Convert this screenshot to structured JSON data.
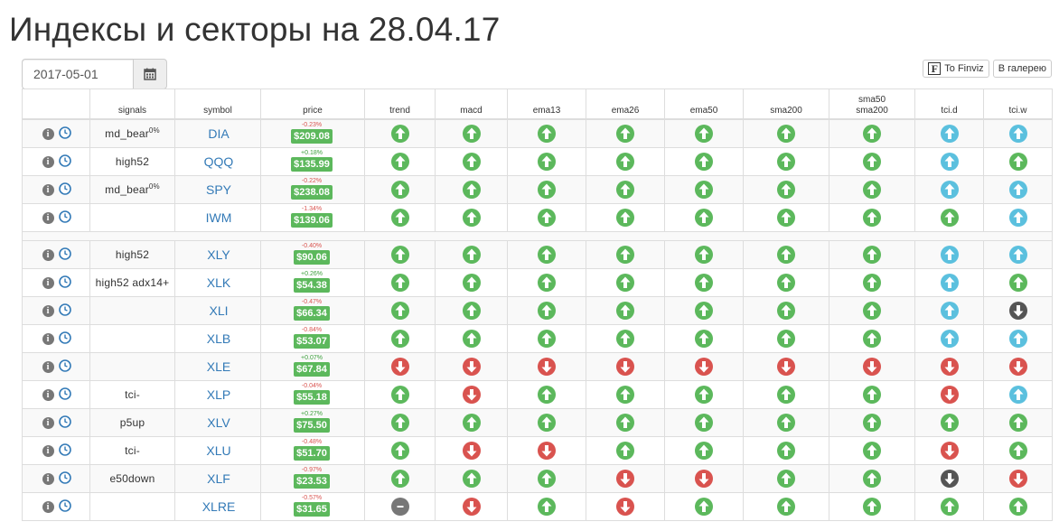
{
  "title": "Индексы и секторы на 28.04.17",
  "date_input": {
    "value": "2017-05-01"
  },
  "buttons": {
    "finviz_icon_letter": "F",
    "finviz_label": "To Finviz",
    "gallery_label": "В галерею"
  },
  "table": {
    "columns": [
      "",
      "signals",
      "symbol",
      "price",
      "trend",
      "macd",
      "ema13",
      "ema26",
      "ema50",
      "sma200",
      "sma50\nsma200",
      "tci.d",
      "tci.w"
    ],
    "column_labels": {
      "signals": "signals",
      "symbol": "symbol",
      "price": "price",
      "trend": "trend",
      "macd": "macd",
      "ema13": "ema13",
      "ema26": "ema26",
      "ema50": "ema50",
      "sma200": "sma200",
      "sma50_sma200_line1": "sma50",
      "sma50_sma200_line2": "sma200",
      "tci_d": "tci.d",
      "tci_w": "tci.w"
    },
    "groups": [
      [
        {
          "symbol": "DIA",
          "signal": "md_bear",
          "signal_sup": "0%",
          "change": "-0.23%",
          "price": "$209.08",
          "indicators": [
            "up",
            "up",
            "up",
            "up",
            "up",
            "up",
            "up",
            "up-blue",
            "up-blue"
          ]
        },
        {
          "symbol": "QQQ",
          "signal": "high52",
          "signal_sup": "",
          "change": "+0.18%",
          "price": "$135.99",
          "indicators": [
            "up",
            "up",
            "up",
            "up",
            "up",
            "up",
            "up",
            "up-blue",
            "up"
          ]
        },
        {
          "symbol": "SPY",
          "signal": "md_bear",
          "signal_sup": "0%",
          "change": "-0.22%",
          "price": "$238.08",
          "indicators": [
            "up",
            "up",
            "up",
            "up",
            "up",
            "up",
            "up",
            "up-blue",
            "up-blue"
          ]
        },
        {
          "symbol": "IWM",
          "signal": "",
          "signal_sup": "",
          "change": "-1.34%",
          "price": "$139.06",
          "indicators": [
            "up",
            "up",
            "up",
            "up",
            "up",
            "up",
            "up",
            "up",
            "up-blue"
          ]
        }
      ],
      [
        {
          "symbol": "XLY",
          "signal": "high52",
          "signal_sup": "",
          "change": "-0.40%",
          "price": "$90.06",
          "indicators": [
            "up",
            "up",
            "up",
            "up",
            "up",
            "up",
            "up",
            "up-blue",
            "up-blue"
          ]
        },
        {
          "symbol": "XLK",
          "signal": "high52 adx14+",
          "signal_sup": "",
          "change": "+0.26%",
          "price": "$54.38",
          "indicators": [
            "up",
            "up",
            "up",
            "up",
            "up",
            "up",
            "up",
            "up-blue",
            "up"
          ]
        },
        {
          "symbol": "XLI",
          "signal": "",
          "signal_sup": "",
          "change": "-0.47%",
          "price": "$66.34",
          "indicators": [
            "up",
            "up",
            "up",
            "up",
            "up",
            "up",
            "up",
            "up-blue",
            "down-dark"
          ]
        },
        {
          "symbol": "XLB",
          "signal": "",
          "signal_sup": "",
          "change": "-0.84%",
          "price": "$53.07",
          "indicators": [
            "up",
            "up",
            "up",
            "up",
            "up",
            "up",
            "up",
            "up-blue",
            "up-blue"
          ]
        },
        {
          "symbol": "XLE",
          "signal": "",
          "signal_sup": "",
          "change": "+0.07%",
          "price": "$67.84",
          "indicators": [
            "down",
            "down",
            "down",
            "down",
            "down",
            "down",
            "down",
            "down",
            "down"
          ]
        },
        {
          "symbol": "XLP",
          "signal": "tci-",
          "signal_sup": "",
          "change": "-0.04%",
          "price": "$55.18",
          "indicators": [
            "up",
            "down",
            "up",
            "up",
            "up",
            "up",
            "up",
            "down",
            "up-blue"
          ]
        },
        {
          "symbol": "XLV",
          "signal": "p5up",
          "signal_sup": "",
          "change": "+0.27%",
          "price": "$75.50",
          "indicators": [
            "up",
            "up",
            "up",
            "up",
            "up",
            "up",
            "up",
            "up",
            "up"
          ]
        },
        {
          "symbol": "XLU",
          "signal": "tci-",
          "signal_sup": "",
          "change": "-0.48%",
          "price": "$51.70",
          "indicators": [
            "up",
            "down",
            "down",
            "up",
            "up",
            "up",
            "up",
            "down",
            "up"
          ]
        },
        {
          "symbol": "XLF",
          "signal": "e50down",
          "signal_sup": "",
          "change": "-0.97%",
          "price": "$23.53",
          "indicators": [
            "up",
            "up",
            "up",
            "down",
            "down",
            "up",
            "up",
            "down-dark",
            "down"
          ]
        },
        {
          "symbol": "XLRE",
          "signal": "",
          "signal_sup": "",
          "change": "-0.57%",
          "price": "$31.65",
          "indicators": [
            "neutral",
            "down",
            "up",
            "down",
            "up",
            "up",
            "up",
            "up",
            "up"
          ]
        }
      ]
    ]
  },
  "colors": {
    "up": "#5cb85c",
    "down": "#d9534f",
    "up_blue": "#5bc0de",
    "down_dark": "#555555",
    "neutral": "#777777",
    "link": "#337ab7",
    "price_badge": "#5cb85c"
  }
}
